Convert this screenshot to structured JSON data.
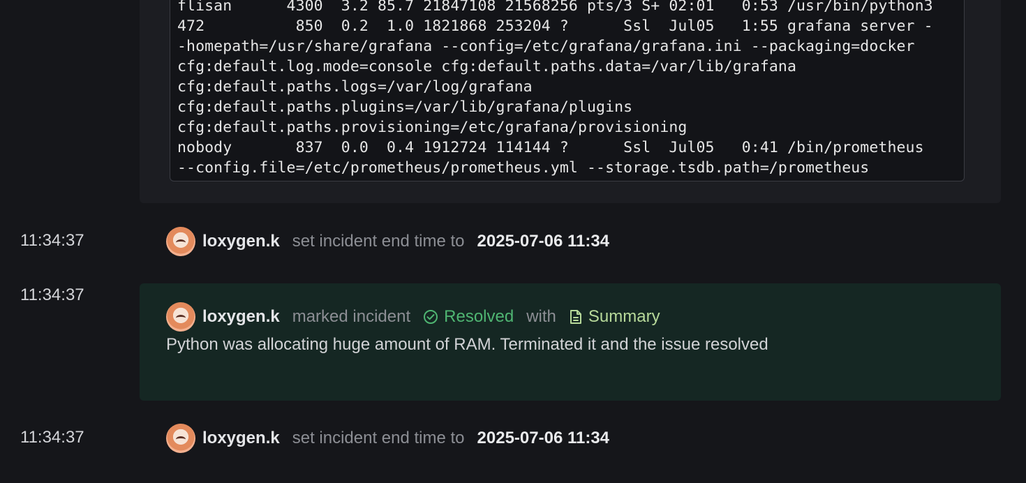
{
  "code_block": {
    "lines": [
      "flisan      4300  3.2 85.7 21847108 21568256 pts/3 S+ 02:01   0:53 /usr/bin/python3",
      "472          850  0.2  1.0 1821868 253204 ?      Ssl  Jul05   1:55 grafana server -",
      "-homepath=/usr/share/grafana --config=/etc/grafana/grafana.ini --packaging=docker",
      "cfg:default.log.mode=console cfg:default.paths.data=/var/lib/grafana",
      "cfg:default.paths.logs=/var/log/grafana",
      "cfg:default.paths.plugins=/var/lib/grafana/plugins",
      "cfg:default.paths.provisioning=/etc/grafana/provisioning",
      "nobody       837  0.0  0.4 1912724 114144 ?      Ssl  Jul05   0:41 /bin/prometheus",
      "--config.file=/etc/prometheus/prometheus.yml --storage.tsdb.path=/prometheus"
    ]
  },
  "events": [
    {
      "time": "11:34:37",
      "user": "loxygen.k",
      "action": "set incident end time to",
      "value": "2025-07-06 11:34"
    },
    {
      "time": "11:34:37",
      "user": "loxygen.k",
      "action": "marked incident",
      "status": "Resolved",
      "connector": "with",
      "attachment": "Summary",
      "message": "Python was allocating huge amount of RAM. Terminated it and the issue resolved"
    },
    {
      "time": "11:34:37",
      "user": "loxygen.k",
      "action": "set incident end time to",
      "value": "2025-07-06 11:34"
    }
  ],
  "icons": {
    "status": "check-circle-icon",
    "attachment": "document-icon",
    "avatar": "user-avatar"
  },
  "colors": {
    "background": "#15161a",
    "resolved_bg": "#152723",
    "resolved_text": "#4fb572",
    "summary_text": "#b7d99a"
  }
}
